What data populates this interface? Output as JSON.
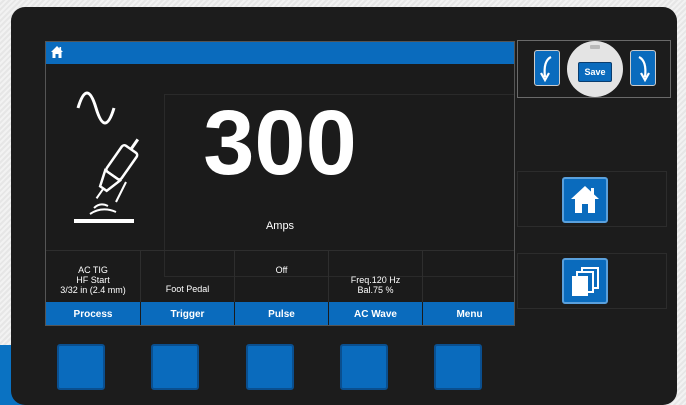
{
  "display": {
    "value": "300",
    "unit": "Amps"
  },
  "info_cells": [
    {
      "lines": [
        "AC TIG",
        "HF Start",
        "3/32 in (2.4 mm)"
      ]
    },
    {
      "lines": [
        "Foot Pedal"
      ]
    },
    {
      "lines": [
        "Off"
      ]
    },
    {
      "lines": [
        "Freq.120 Hz",
        "Bal.75 %"
      ]
    },
    {
      "lines": []
    }
  ],
  "softkeys": [
    "Process",
    "Trigger",
    "Pulse",
    "AC Wave",
    "Menu"
  ],
  "save": {
    "label": "Save"
  },
  "icons": {
    "home_small": "home-icon",
    "process": "tig-torch-ac-icon",
    "memory_prev": "arrow-curve-down-left-icon",
    "memory_next": "arrow-curve-down-right-icon",
    "home": "home-icon",
    "pages": "pages-stack-icon"
  },
  "colors": {
    "accent": "#0a6bbd",
    "device": "#1c1c1c",
    "text": "#ffffff"
  }
}
